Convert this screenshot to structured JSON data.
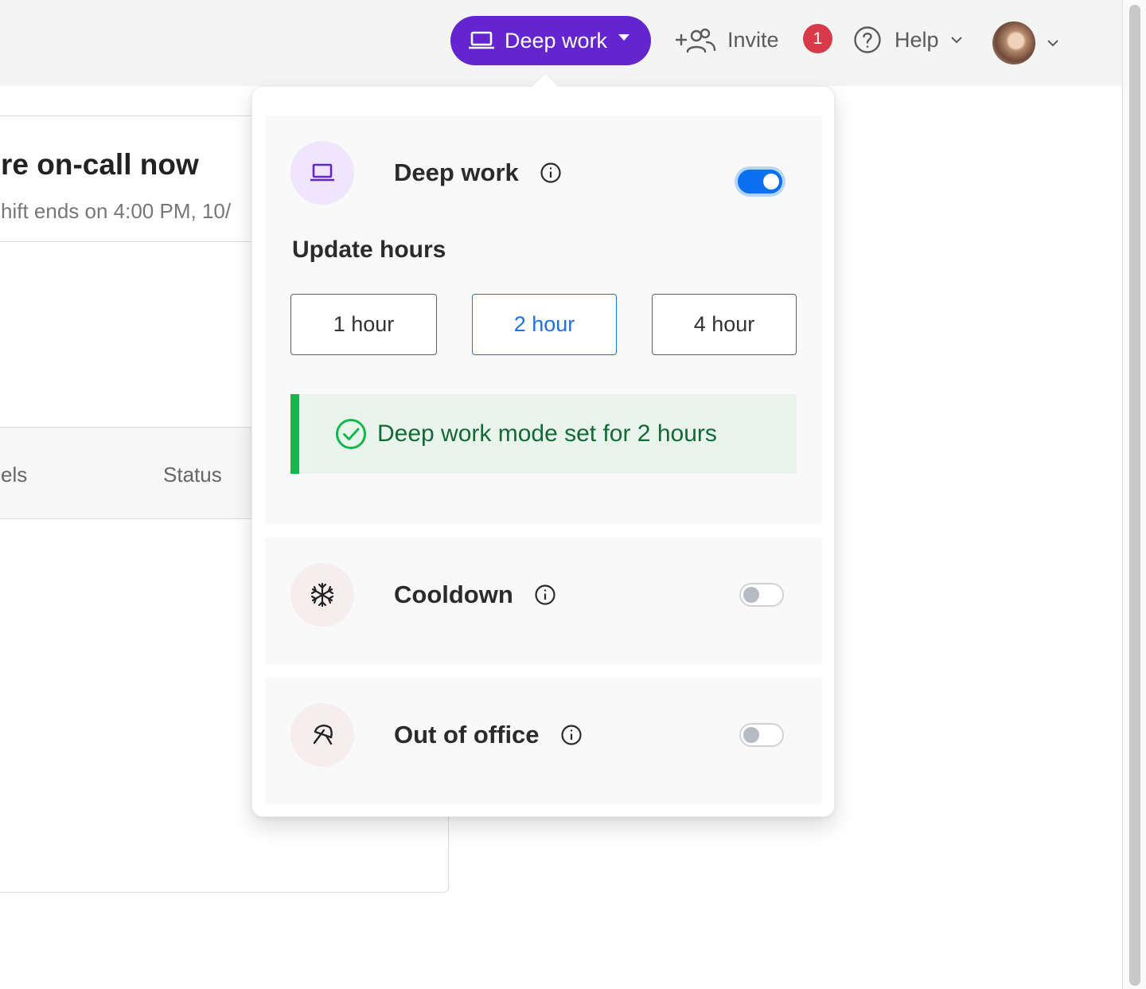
{
  "header": {
    "status_button_label": "Deep work",
    "invite_label": "Invite",
    "notification_count": "1",
    "help_label": "Help"
  },
  "background": {
    "title": "re on-call now",
    "subtitle": "hift ends on 4:00 PM, 10/",
    "table_headers": [
      "els",
      "Status"
    ]
  },
  "dropdown": {
    "deep_work": {
      "label": "Deep work",
      "enabled": true,
      "update_hours_label": "Update hours",
      "hour_options": [
        "1 hour",
        "2 hour",
        "4 hour"
      ],
      "selected_option": "2 hour",
      "alert_message": "Deep work mode set for 2 hours"
    },
    "cooldown": {
      "label": "Cooldown",
      "enabled": false
    },
    "out_of_office": {
      "label": "Out of office",
      "enabled": false
    }
  },
  "colors": {
    "accent_purple": "#6424cf",
    "toggle_on_blue": "#0a6ff0",
    "selected_blue": "#1a73e8",
    "success_green": "#12b84c",
    "badge_red": "#d93a4a"
  },
  "icons": {
    "status_button": "laptop-icon",
    "invite": "add-users-icon",
    "help": "question-circle-icon",
    "deep_work": "laptop-icon",
    "cooldown": "snowflake-icon",
    "out_of_office": "umbrella-icon",
    "info": "info-icon",
    "alert": "check-circle-icon"
  }
}
